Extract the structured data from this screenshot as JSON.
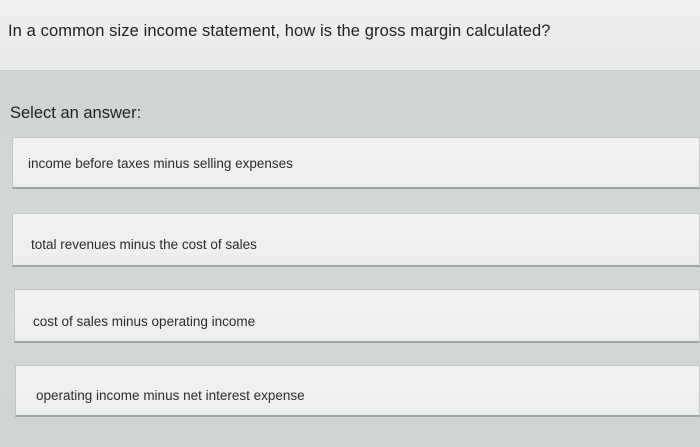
{
  "question": {
    "text": "In a common size income statement, how is the gross margin calculated?"
  },
  "answers": {
    "prompt": "Select an answer:",
    "options": [
      {
        "label": "income before taxes minus selling expenses"
      },
      {
        "label": "total revenues minus the cost of sales"
      },
      {
        "label": "cost of sales minus operating income"
      },
      {
        "label": "operating income minus net interest expense"
      }
    ]
  },
  "colors": {
    "page_background": "#d4d8d7",
    "question_background": "#eef0ef",
    "option_background": "#f1f2f1",
    "text": "#202223"
  }
}
